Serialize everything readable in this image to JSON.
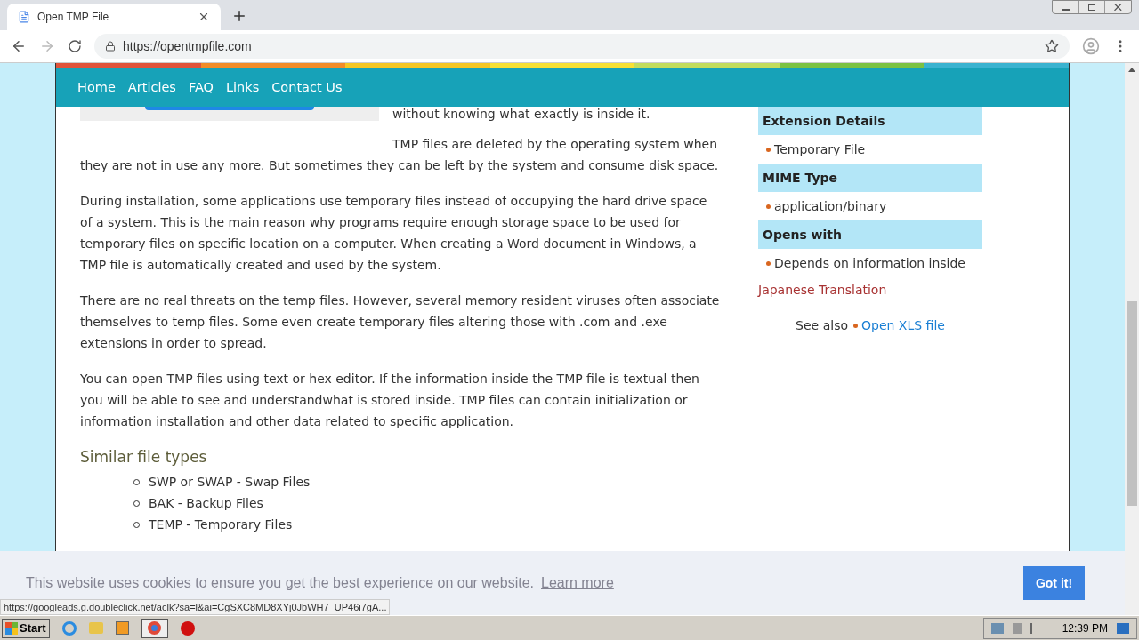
{
  "browser": {
    "tab_title": "Open TMP File",
    "url": "https://opentmpfile.com"
  },
  "nav": [
    "Home",
    "Articles",
    "FAQ",
    "Links",
    "Contact Us"
  ],
  "article": {
    "paragraphs": [
      "without knowing what exactly is inside it.",
      "TMP files are deleted by the operating system when they are not in use any more. But sometimes they can be left by the system and consume disk space.",
      "During installation, some applications use temporary files instead of occupying the hard drive space of a system. This is the main reason why programs require enough storage space to be used for temporary files on specific location on a computer. When creating a Word document in Windows, a TMP file is automatically created and used by the system.",
      "There are no real threats on the temp files. However, several memory resident viruses often associate themselves to temp files. Some even create temporary files altering those with .com and .exe extensions in order to spread.",
      "You can open TMP files using text or hex editor. If the information inside the TMP file is textual then you will be able to see and understandwhat is stored inside. TMP files can contain initialization or information installation and other data related to specific application."
    ],
    "similar_heading": "Similar file types",
    "similar": [
      "SWP or SWAP - Swap Files",
      "BAK - Backup Files",
      "TEMP - Temporary Files"
    ]
  },
  "sidebar": {
    "sections": [
      {
        "heading": "Extension Details",
        "items": [
          "Temporary File"
        ]
      },
      {
        "heading": "MIME Type",
        "items": [
          "application/binary"
        ]
      },
      {
        "heading": "Opens with",
        "items": [
          "Depends on information inside"
        ]
      }
    ],
    "translation_link": "Japanese Translation",
    "see_also_label": "See also",
    "see_also_link": "Open XLS file"
  },
  "cookie": {
    "message": "This website uses cookies to ensure you get the best experience on our website.",
    "link": "Learn more",
    "button": "Got it!"
  },
  "status_url": "https://googleads.g.doubleclick.net/aclk?sa=l&ai=CgSXC8MD8XYj0JbWH7_UP46i7gA...",
  "taskbar": {
    "start": "Start",
    "clock": "12:39 PM"
  }
}
